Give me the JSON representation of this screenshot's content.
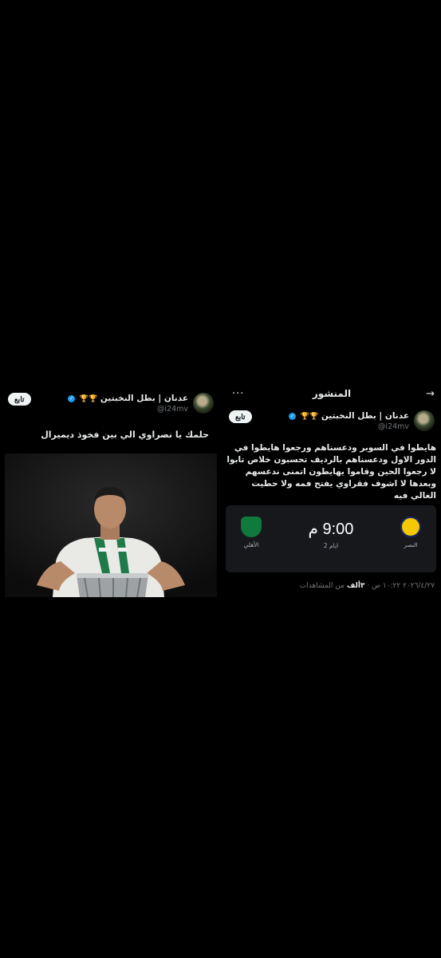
{
  "left_post": {
    "author": {
      "name": "عدنان | بطل النخبتين",
      "trophies": "🏆🏆",
      "handle": "@i24mv"
    },
    "follow_label": "تابع",
    "text": "حلمك يا نصراوي الي بين فخوذ ديميرال"
  },
  "right_post": {
    "header_title": "المنشور",
    "back_icon": "→",
    "more_icon": "···",
    "author": {
      "name": "عدنان | بطل النخبتين",
      "trophies": "🏆🏆",
      "handle": "@i24mv"
    },
    "follow_label": "تابع",
    "text": "هايطوا في السوبر ودعسناهم ورجعوا هايطوا في الدور الاول ودعسناهم بالرديف تحسبون خلاص تابوا لا رجعوا الحين وقاموا يهايطون اتمنى ندعسهم وبعدها لا اشوف فقراوي يفتح فمه ولا حطيت الغالي فيه",
    "match": {
      "home_team": "النصر",
      "away_team": "الأهلي",
      "time": "9:00 م",
      "subtitle": "2 ايام",
      "home_color": "#f5c800",
      "away_color": "#0f7a3c"
    },
    "meta": {
      "datetime": "٢٠٢٦/٤/٢٧ ١٠:٢٢ ص · ",
      "views_count": "٣ألف",
      "views_label": " من المشاهدات"
    }
  }
}
